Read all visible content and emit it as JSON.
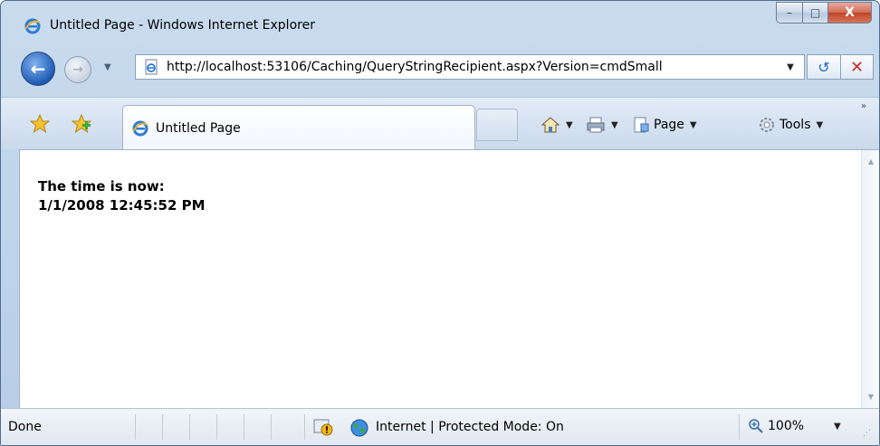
{
  "window": {
    "title": "Untitled Page - Windows Internet Explorer",
    "minimize_glyph": "–",
    "maximize_glyph": "□",
    "close_glyph": "X"
  },
  "nav": {
    "url": "http://localhost:53106/Caching/QueryStringRecipient.aspx?Version=cmdSmall",
    "back_glyph": "←",
    "forward_glyph": "→",
    "dropdown_glyph": "▼",
    "refresh_glyph": "↺",
    "stop_glyph": "✕"
  },
  "tabs": {
    "active_label": "Untitled Page"
  },
  "commands": {
    "page_label": "Page",
    "tools_label": "Tools",
    "dropdown_glyph": "▼",
    "more_glyph": "»"
  },
  "content": {
    "line1": "The time is now:",
    "line2": "1/1/2008 12:45:52 PM"
  },
  "status": {
    "text": "Done",
    "zone": "Internet | Protected Mode: On",
    "zoom": "100%",
    "zoom_dropdown_glyph": "▼"
  },
  "colors": {
    "accent": "#1f5bb5",
    "close_red": "#c0452c",
    "chrome": "#c9dcee"
  },
  "icons": [
    "ie-icon",
    "back-arrow-icon",
    "forward-arrow-icon",
    "page-icon",
    "refresh-icon",
    "stop-icon",
    "favorites-star-icon",
    "add-favorites-icon",
    "home-icon",
    "print-icon",
    "page-menu-icon",
    "tools-gear-icon",
    "warning-shield-icon",
    "globe-icon",
    "zoom-icon"
  ]
}
